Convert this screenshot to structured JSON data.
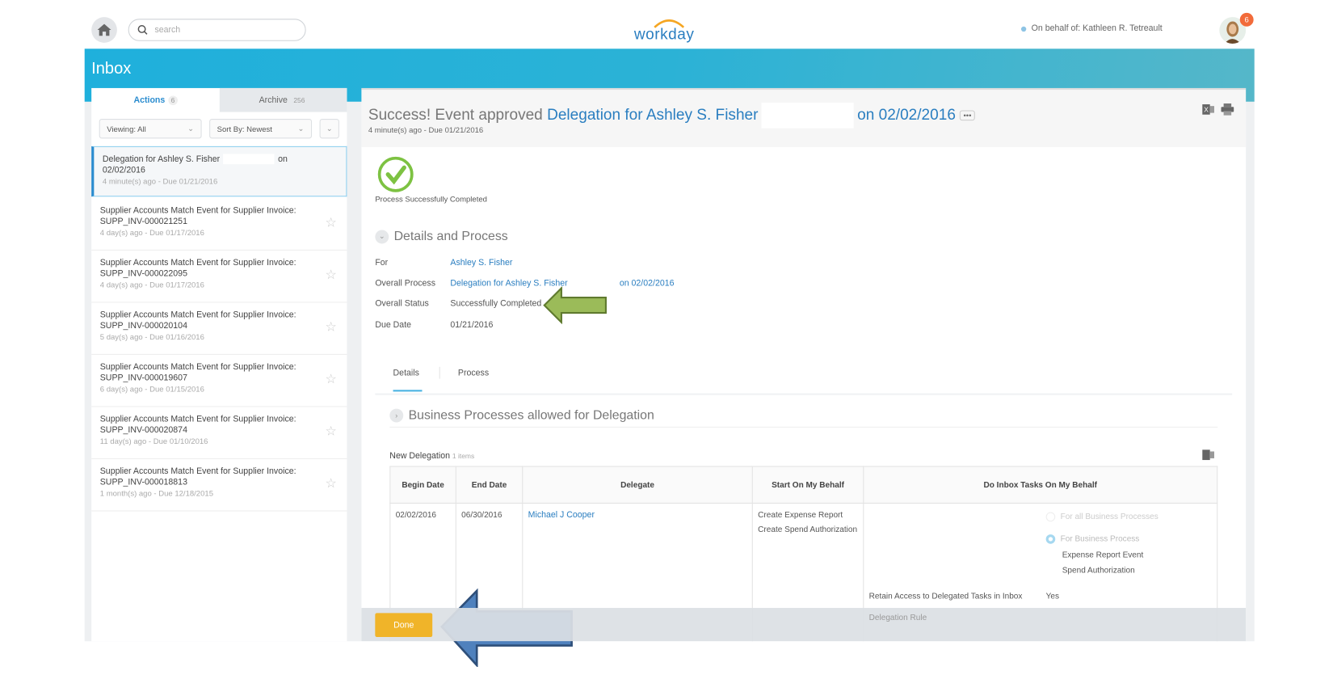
{
  "header": {
    "search_placeholder": "search",
    "logo": "workday",
    "behalf": "On behalf of: Kathleen R. Tetreault",
    "notif_count": "6"
  },
  "page_title": "Inbox",
  "left": {
    "tabs": [
      {
        "label": "Actions",
        "count": "6"
      },
      {
        "label": "Archive",
        "count": "256"
      }
    ],
    "viewing": "Viewing: All",
    "sort": "Sort By: Newest",
    "selected": {
      "title": "Delegation for Ashley S. Fisher",
      "title2": "on",
      "date": "02/02/2016",
      "meta": "4 minute(s) ago - Due 01/21/2016"
    },
    "items": [
      {
        "title": "Supplier Accounts Match Event for Supplier Invoice:",
        "id": "SUPP_INV-000021251",
        "meta": "4 day(s) ago - Due 01/17/2016"
      },
      {
        "title": "Supplier Accounts Match Event for Supplier Invoice:",
        "id": "SUPP_INV-000022095",
        "meta": "4 day(s) ago - Due 01/17/2016"
      },
      {
        "title": "Supplier Accounts Match Event for Supplier Invoice:",
        "id": "SUPP_INV-000020104",
        "meta": "5 day(s) ago - Due 01/16/2016"
      },
      {
        "title": "Supplier Accounts Match Event for Supplier Invoice:",
        "id": "SUPP_INV-000019607",
        "meta": "6 day(s) ago - Due 01/15/2016"
      },
      {
        "title": "Supplier Accounts Match Event for Supplier Invoice:",
        "id": "SUPP_INV-000020874",
        "meta": "11 day(s) ago - Due 01/10/2016"
      },
      {
        "title": "Supplier Accounts Match Event for Supplier Invoice:",
        "id": "SUPP_INV-000018813",
        "meta": "1 month(s) ago - Due 12/18/2015"
      }
    ]
  },
  "detail": {
    "prefix": "Success! Event approved",
    "link": "Delegation for Ashley S. Fisher",
    "link2": "on 02/02/2016",
    "sub": "4 minute(s) ago - Due 01/21/2016",
    "status_text": "Process Successfully Completed",
    "section": "Details and Process",
    "fields": {
      "for_label": "For",
      "for_value": "Ashley S. Fisher",
      "proc_label": "Overall Process",
      "proc_value": "Delegation for Ashley S. Fisher",
      "proc_value2": "on 02/02/2016",
      "status_label": "Overall Status",
      "status_value": "Successfully Completed",
      "due_label": "Due Date",
      "due_value": "01/21/2016"
    },
    "tabs": [
      "Details",
      "Process"
    ],
    "bp_section": "Business Processes allowed for Delegation",
    "table": {
      "title": "New Delegation",
      "count": "1 items",
      "headers": [
        "Begin Date",
        "End Date",
        "Delegate",
        "Start On My Behalf",
        "Do Inbox Tasks On My Behalf"
      ],
      "row": {
        "begin": "02/02/2016",
        "end": "06/30/2016",
        "delegate": "Michael J Cooper",
        "start1": "Create Expense Report",
        "start2": "Create Spend Authorization",
        "opt_all": "For all Business Processes",
        "opt_bp": "For Business Process",
        "bp1": "Expense Report Event",
        "bp2": "Spend Authorization",
        "retain_label": "Retain Access to Delegated Tasks in Inbox",
        "retain_value": "Yes",
        "rule_label": "Delegation Rule"
      }
    }
  },
  "footer": {
    "done": "Done"
  }
}
